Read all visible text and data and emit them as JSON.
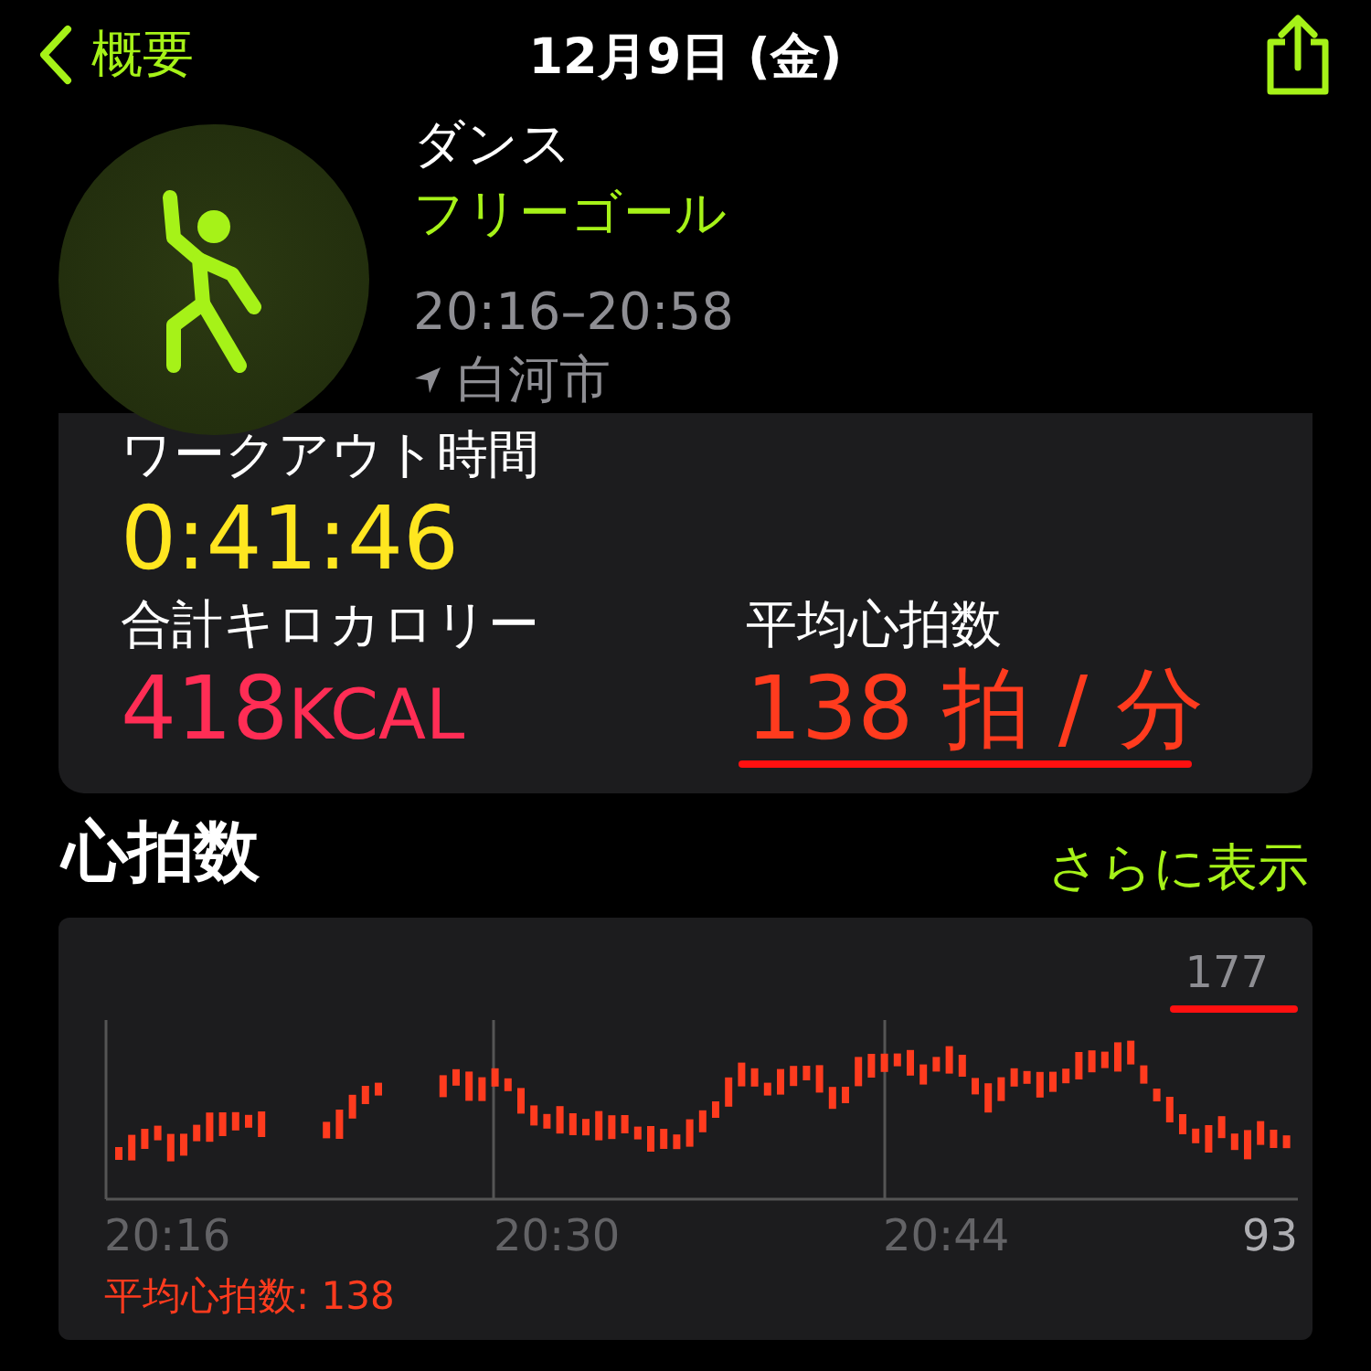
{
  "nav": {
    "back_label": "概要",
    "title": "12月9日 (金)"
  },
  "workout": {
    "type": "ダンス",
    "goal": "フリーゴール",
    "time_range": "20:16–20:58",
    "location": "白河市"
  },
  "summary": {
    "duration_label": "ワークアウト時間",
    "duration": "0:41:46",
    "calories_label": "合計キロカロリー",
    "calories": "418",
    "calories_unit": "KCAL",
    "avg_hr_label": "平均心拍数",
    "avg_hr": "138",
    "avg_hr_unit": "拍 / 分"
  },
  "heart_rate": {
    "title": "心拍数",
    "more_link": "さらに表示",
    "max": "177",
    "min": "93",
    "time_labels": [
      "20:16",
      "20:30",
      "20:44"
    ],
    "average": "平均心拍数: 138"
  }
}
